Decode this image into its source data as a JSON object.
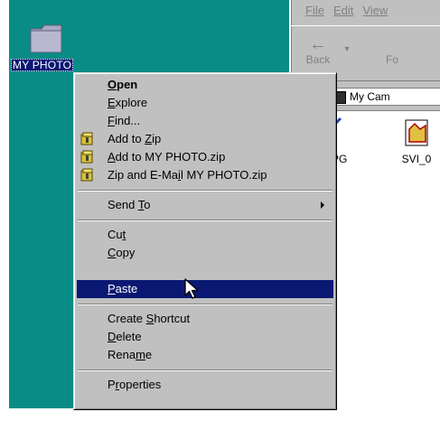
{
  "desktop": {
    "folder_label": "MY PHOTO",
    "background": "#098c86"
  },
  "explorer": {
    "menu": [
      "File",
      "Edit",
      "View"
    ],
    "toolbar": {
      "back": "Back",
      "forward": "Fo"
    },
    "address_label": "ess",
    "address_value": "My Cam",
    "files": [
      "001.JPG",
      "SVI_0"
    ]
  },
  "context_menu": {
    "items": [
      {
        "pre": "",
        "key": "O",
        "post": "pen",
        "icon": "",
        "state": "default"
      },
      {
        "pre": "",
        "key": "E",
        "post": "xplore",
        "icon": "",
        "state": "normal"
      },
      {
        "pre": "",
        "key": "F",
        "post": "ind...",
        "icon": "",
        "state": "normal"
      },
      {
        "pre": "Add to ",
        "key": "Z",
        "post": "ip",
        "icon": "winzip-icon",
        "state": "normal"
      },
      {
        "pre": "",
        "key": "A",
        "post": "dd to MY PHOTO.zip",
        "icon": "winzip-icon",
        "state": "normal"
      },
      {
        "pre": "Zip and E-Ma",
        "key": "i",
        "post": "l MY PHOTO.zip",
        "icon": "winzip-icon",
        "state": "normal"
      },
      {
        "pre": "Send ",
        "key": "T",
        "post": "o",
        "icon": "",
        "state": "submenu"
      },
      {
        "pre": "Cu",
        "key": "t",
        "post": "",
        "icon": "",
        "state": "normal"
      },
      {
        "pre": "",
        "key": "C",
        "post": "opy",
        "icon": "",
        "state": "normal"
      },
      {
        "pre": "",
        "key": "P",
        "post": "aste",
        "icon": "",
        "state": "highlighted"
      },
      {
        "pre": "Create ",
        "key": "S",
        "post": "hortcut",
        "icon": "",
        "state": "normal"
      },
      {
        "pre": "",
        "key": "D",
        "post": "elete",
        "icon": "",
        "state": "normal"
      },
      {
        "pre": "Rena",
        "key": "m",
        "post": "e",
        "icon": "",
        "state": "normal"
      },
      {
        "pre": "P",
        "key": "r",
        "post": "operties",
        "icon": "",
        "state": "normal"
      }
    ],
    "highlight_color": "#0a1873",
    "menu_color": "#c0c0c0"
  }
}
